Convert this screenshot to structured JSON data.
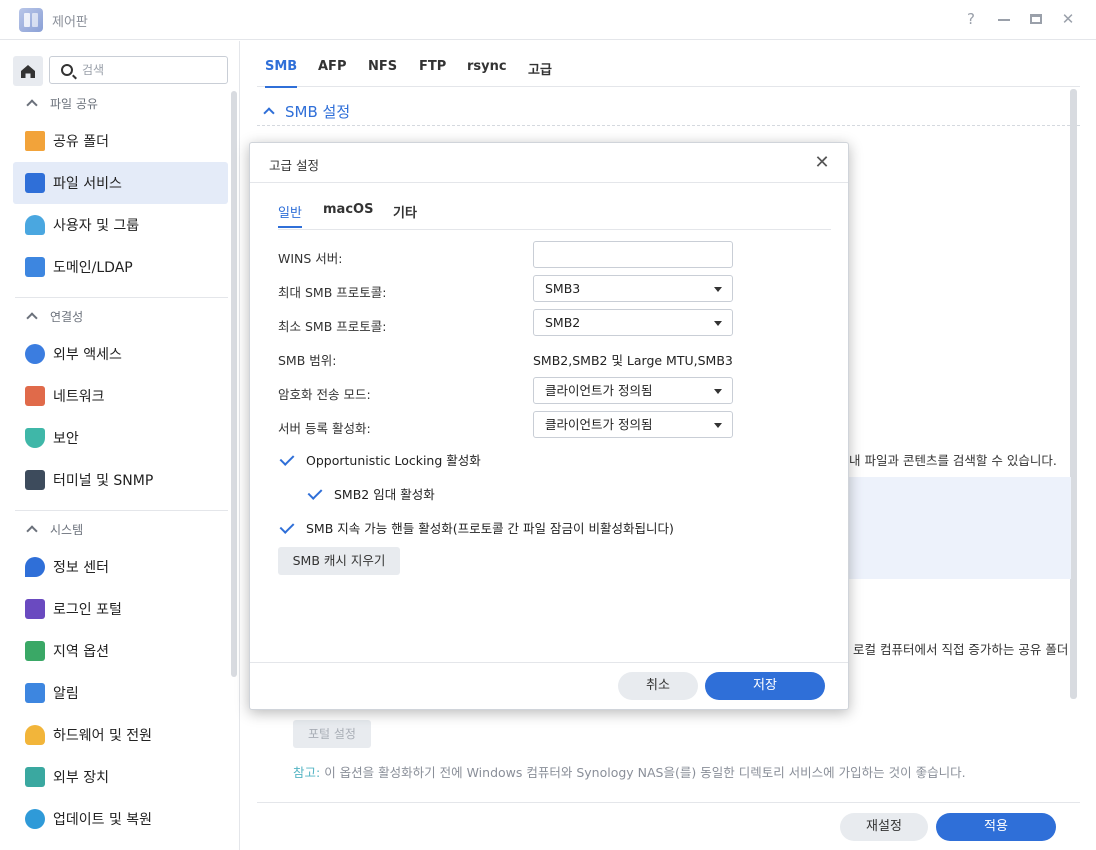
{
  "window": {
    "title": "제어판"
  },
  "sidebar": {
    "search_placeholder": "검색",
    "sections": [
      {
        "label": "파일 공유",
        "items": [
          {
            "label": "공유 폴더",
            "color": "#f2a33a"
          },
          {
            "label": "파일 서비스",
            "color": "#2f6fd8",
            "active": true
          },
          {
            "label": "사용자 및 그룹",
            "color": "#4aa7e0"
          },
          {
            "label": "도메인/LDAP",
            "color": "#3d86e0"
          }
        ]
      },
      {
        "label": "연결성",
        "items": [
          {
            "label": "외부 액세스",
            "color": "#3b7de0"
          },
          {
            "label": "네트워크",
            "color": "#e06a4a"
          },
          {
            "label": "보안",
            "color": "#3fb7a8"
          },
          {
            "label": "터미널 및 SNMP",
            "color": "#3d4b5c"
          }
        ]
      },
      {
        "label": "시스템",
        "items": [
          {
            "label": "정보 센터",
            "color": "#2f6fd8"
          },
          {
            "label": "로그인 포털",
            "color": "#6a4ac0"
          },
          {
            "label": "지역 옵션",
            "color": "#3aa866"
          },
          {
            "label": "알림",
            "color": "#3d86e0"
          },
          {
            "label": "하드웨어 및 전원",
            "color": "#f2b53a"
          },
          {
            "label": "외부 장치",
            "color": "#3aa8a0"
          },
          {
            "label": "업데이트 및 복원",
            "color": "#2f9ad8"
          }
        ]
      }
    ]
  },
  "main": {
    "tabs": [
      "SMB",
      "AFP",
      "NFS",
      "FTP",
      "rsync",
      "고급"
    ],
    "section_title": "SMB 설정",
    "bg_text_1": "내 파일과 콘텐츠를 검색할 수 있습니다.",
    "bg_text_2": "로컬 컴퓨터에서 직접 증가하는 공유 폴더",
    "portal_button": "포털 설정",
    "note_prefix": "참고:",
    "note_text": " 이 옵션을 활성화하기 전에 Windows 컴퓨터와 Synology NAS을(를) 동일한 디렉토리 서비스에 가입하는 것이 좋습니다.",
    "reset_button": "재설정",
    "apply_button": "적용"
  },
  "modal": {
    "title": "고급 설정",
    "tabs": [
      "일반",
      "macOS",
      "기타"
    ],
    "fields": {
      "wins_label": "WINS 서버:",
      "wins_value": "",
      "max_smb_label": "최대 SMB 프로토콜:",
      "max_smb_value": "SMB3",
      "min_smb_label": "최소 SMB 프로토콜:",
      "min_smb_value": "SMB2",
      "smb_range_label": "SMB 범위:",
      "smb_range_value": "SMB2,SMB2 및 Large MTU,SMB3",
      "encrypt_label": "암호화 전송 모드:",
      "encrypt_value": "클라이언트가 정의됨",
      "signing_label": "서버 등록 활성화:",
      "signing_value": "클라이언트가 정의됨"
    },
    "checks": {
      "oplock": "Opportunistic Locking 활성화",
      "lease": "SMB2 임대 활성화",
      "durable": "SMB 지속 가능 핸들 활성화(프로토콜 간 파일 잠금이 비활성화됩니다)"
    },
    "cache_button": "SMB 캐시 지우기",
    "cancel_button": "취소",
    "save_button": "저장"
  }
}
